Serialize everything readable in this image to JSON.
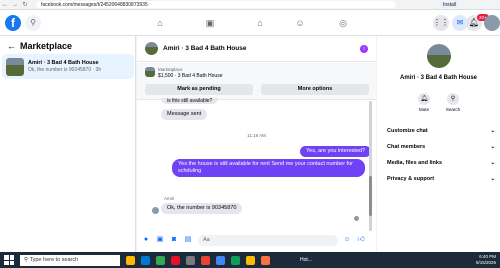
{
  "browser": {
    "url": "facebook.com/messages/t/24520648830873935",
    "install_label": "Install"
  },
  "topnav": {
    "notification_count": "20+"
  },
  "left": {
    "title": "Marketplace",
    "thread": {
      "name": "Amiri · 3 Bad 4 Bath House",
      "preview": "Ok, the number is 90345870 · 3h"
    }
  },
  "chat": {
    "title": "Amiri · 3 Bad 4 Bath House",
    "listing_label": "Marketplace",
    "listing_price": "$1,500 · 3 Bad 4 Bath House",
    "btn_pending": "Mark as pending",
    "btn_more": "More options",
    "msg_partial": "is this still available?",
    "msg_sent": "Message sent",
    "timestamp": "11:18 AM",
    "msg_out1": "Yes, are you interested?",
    "msg_out2": "Yes the house is still available for rent Send me your contact number for schduling",
    "sender": "Amiri",
    "msg_in_last": "Ok, the number is 90345870",
    "composer_placeholder": "Aa"
  },
  "right": {
    "name": "Amiri · 3 Bad 4 Bath House",
    "mute": "Mute",
    "search": "Search",
    "rows": [
      "Customize chat",
      "Chat members",
      "Media, files and links",
      "Privacy & support"
    ]
  },
  "taskbar": {
    "search_placeholder": "Type here to search",
    "weather": "Hot...",
    "time": "6:40 PM",
    "date": "5/15/2026"
  }
}
